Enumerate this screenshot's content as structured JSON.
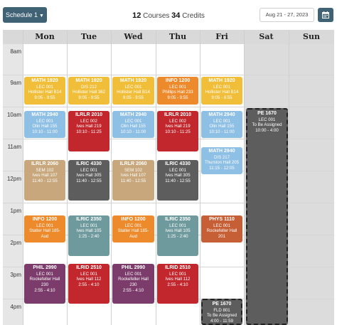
{
  "header": {
    "schedule_button": "Schedule 1",
    "courses_count": "12",
    "courses_label": "Courses",
    "credits_count": "34",
    "credits_label": "Credits",
    "date_range": "Aug 21 - 27, 2023",
    "calendar_icon": "calendar-icon"
  },
  "days": [
    "Mon",
    "Tue",
    "Wed",
    "Thu",
    "Fri",
    "Sat",
    "Sun"
  ],
  "hours": [
    "8am",
    "9am",
    "10am",
    "11am",
    "12pm",
    "1pm",
    "2pm",
    "3pm",
    "4pm"
  ],
  "colors": {
    "yellow": "#f0be38",
    "red": "#c1272d",
    "blue": "#8ebfe4",
    "tan": "#c7a77b",
    "gray": "#5d5d5d",
    "orange": "#ec8a2c",
    "teal": "#6f9a9d",
    "rust": "#c65f36",
    "purple": "#7b3c6b",
    "accent": "#3f6275"
  },
  "events": {
    "mon_math": {
      "title": "MATH 1920",
      "section": "LEC 001",
      "place": "Hollister Hall B14",
      "time": "9:05 - 9:55"
    },
    "tue_math": {
      "title": "MATH 1920",
      "section": "DIS 212",
      "place": "Hollister Hall 362",
      "time": "9:05 - 9:55"
    },
    "wed_math": {
      "title": "MATH 1920",
      "section": "LEC 001",
      "place": "Hollister Hall B14",
      "time": "9:05 - 9:55"
    },
    "thu_info": {
      "title": "INFO 1200",
      "section": "LEC 001",
      "place": "Phillips Hall 233",
      "time": "9:05 - 9:55"
    },
    "fri_math": {
      "title": "MATH 1920",
      "section": "LEC 001",
      "place": "Hollister Hall B14",
      "time": "9:05 - 9:55"
    },
    "mon_math2": {
      "title": "MATH 2940",
      "section": "LEC 001",
      "place": "Olin Hall 155",
      "time": "10:10 - 11:00"
    },
    "tue_ilrlr": {
      "title": "ILRLR 2010",
      "section": "LEC 002",
      "place": "Ives Hall 219",
      "time": "10:10 - 11:25"
    },
    "wed_math2": {
      "title": "MATH 2940",
      "section": "LEC 001",
      "place": "Olin Hall 155",
      "time": "10:10 - 11:00"
    },
    "thu_ilrlr": {
      "title": "ILRLR 2010",
      "section": "LEC 002",
      "place": "Ives Hall 219",
      "time": "10:10 - 11:25"
    },
    "fri_math2": {
      "title": "MATH 2940",
      "section": "LEC 001",
      "place": "Olin Hall 155",
      "time": "10:10 - 11:00"
    },
    "sat_pe": {
      "title": "PE 1670",
      "section": "LEC 001",
      "place": "To Be Assigned",
      "time": "10:00 - 4:00"
    },
    "fri_math3": {
      "title": "MATH 2940",
      "section": "DIS 217",
      "place": "Thurston Hall 205",
      "time": "11:15 - 12:05"
    },
    "mon_ilrlr": {
      "title": "ILRLR 2060",
      "section": "SEM 102",
      "place": "Ives Hall 107",
      "time": "11:40 - 12:55"
    },
    "tue_ilric": {
      "title": "ILRIC 4330",
      "section": "LEC 001",
      "place": "Ives Hall 305",
      "time": "11:40 - 12:55"
    },
    "wed_ilrlr": {
      "title": "ILRLR 2060",
      "section": "SEM 102",
      "place": "Ives Hall 107",
      "time": "11:40 - 12:55"
    },
    "thu_ilric": {
      "title": "ILRIC 4330",
      "section": "LEC 001",
      "place": "Ives Hall 305",
      "time": "11:40 - 12:55"
    },
    "mon_info": {
      "title": "INFO 1200",
      "section": "LEC 001",
      "place": "Statler Hall 185-",
      "place2": "Aud"
    },
    "tue_ilric2": {
      "title": "ILRIC 2350",
      "section": "LEC 001",
      "place": "Ives Hall 105",
      "time": "1:25 - 2:40"
    },
    "wed_info": {
      "title": "INFO 1200",
      "section": "LEC 001",
      "place": "Statler Hall 185-",
      "place2": "Aud"
    },
    "thu_ilric2": {
      "title": "ILRIC 2350",
      "section": "LEC 001",
      "place": "Ives Hall 105",
      "time": "1:25 - 2:40"
    },
    "fri_phys": {
      "title": "PHYS 1110",
      "section": "LEC 001",
      "place": "Rockefeller Hall",
      "place2": "201"
    },
    "mon_phil": {
      "title": "PHIL 2990",
      "section": "LEC 001",
      "place": "Rockefeller Hall",
      "place2": "230",
      "time": "2:55 - 4:10"
    },
    "tue_ilrid": {
      "title": "ILRID 2510",
      "section": "LEC 001",
      "place": "Ives Hall 112",
      "time": "2:55 - 4:10"
    },
    "wed_phil": {
      "title": "PHIL 2990",
      "section": "LEC 001",
      "place": "Rockefeller Hall",
      "place2": "230",
      "time": "2:55 - 4:10"
    },
    "thu_ilrid": {
      "title": "ILRID 2510",
      "section": "LEC 001",
      "place": "Ives Hall 112",
      "time": "2:55 - 4:10"
    },
    "fri_pe": {
      "title": "PE 1670",
      "section": "FLD 801",
      "place": "To Be Assigned",
      "time": "4:00 - 11:59"
    }
  }
}
